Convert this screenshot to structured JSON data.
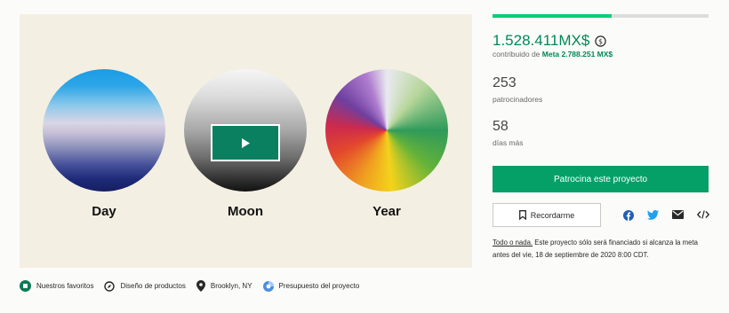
{
  "video": {
    "captions": [
      "Day",
      "Moon",
      "Year"
    ]
  },
  "tags": [
    {
      "label": "Nuestros favoritos",
      "icon": "kickstarter-badge-icon"
    },
    {
      "label": "Diseño de productos",
      "icon": "compass-icon"
    },
    {
      "label": "Brooklyn, NY",
      "icon": "location-pin-icon"
    },
    {
      "label": "Presupuesto del proyecto",
      "icon": "budget-icon"
    }
  ],
  "funding": {
    "progress_fraction": 0.55,
    "pledged": "1.528.411MX$",
    "contributed_prefix": "contribuido de ",
    "goal": "Meta 2.788.251 MX$",
    "backers_count": "253",
    "backers_label": "patrocinadores",
    "days_count": "58",
    "days_label": "días más"
  },
  "actions": {
    "back_label": "Patrocina este proyecto",
    "remind_label": "Recordarme",
    "share_icons": [
      "facebook-icon",
      "twitter-icon",
      "email-icon",
      "embed-icon"
    ]
  },
  "note": {
    "link_text": "Todo o nada.",
    "text": " Este proyecto sólo será financiado si alcanza la meta antes del vie, 18 de septiembre de 2020 8:00 CDT."
  },
  "colors": {
    "accent_green": "#028858",
    "button_green": "#05a068",
    "progress_green": "#05ce78",
    "media_background": "#f4efe3"
  }
}
